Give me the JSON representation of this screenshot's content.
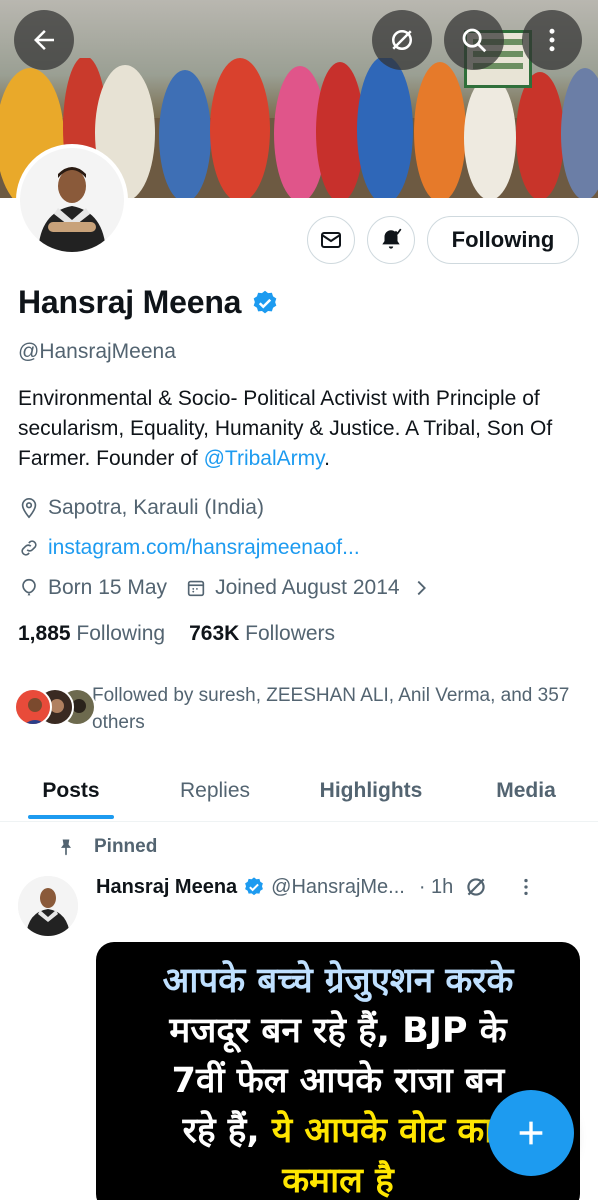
{
  "profile": {
    "name": "Hansraj Meena",
    "handle": "@HansrajMeena",
    "bio_main": "Environmental & Socio- Political Activist with Principle of secularism, Equality, Humanity & Justice. A Tribal, Son Of Farmer. Founder of ",
    "bio_link": "@TribalArmy",
    "bio_end": ".",
    "location": "Sapotra, Karauli (India)",
    "website": "instagram.com/hansrajmeenaof...",
    "born": "Born 15 May",
    "joined": "Joined August 2014",
    "following_count": "1,885",
    "following_label": "Following",
    "followers_count": "763K",
    "followers_label": "Followers",
    "followed_by": "Followed by suresh, ZEESHAN ALI, Anil Verma, and 357 others"
  },
  "actions": {
    "following_button": "Following"
  },
  "tabs": [
    {
      "label": "Posts"
    },
    {
      "label": "Replies"
    },
    {
      "label": "Highlights"
    },
    {
      "label": "Media"
    }
  ],
  "pinned_post": {
    "pinned_label": "Pinned",
    "author_name": "Hansraj Meena",
    "author_handle": "@HansrajMe...",
    "time": "· 1h",
    "image_lines": [
      "आपके बच्चे ग्रेजुएशन करके",
      "मजदूर बन रहे हैं, BJP के",
      "7वीं फेल आपके राजा बन",
      "रहे हैं,",
      "ये आपके वोट का",
      "कमाल है"
    ]
  },
  "colors": {
    "accent": "#1d9bf0",
    "text_primary": "#0f1419",
    "text_secondary": "#536471",
    "border": "#cfd9de"
  },
  "icons": [
    "back-arrow-icon",
    "grok-icon",
    "search-icon",
    "more-vertical-icon",
    "mail-icon",
    "bell-icon",
    "verified-badge-icon",
    "location-icon",
    "link-icon",
    "balloon-icon",
    "calendar-icon",
    "chevron-right-icon",
    "pin-icon",
    "plus-icon"
  ]
}
